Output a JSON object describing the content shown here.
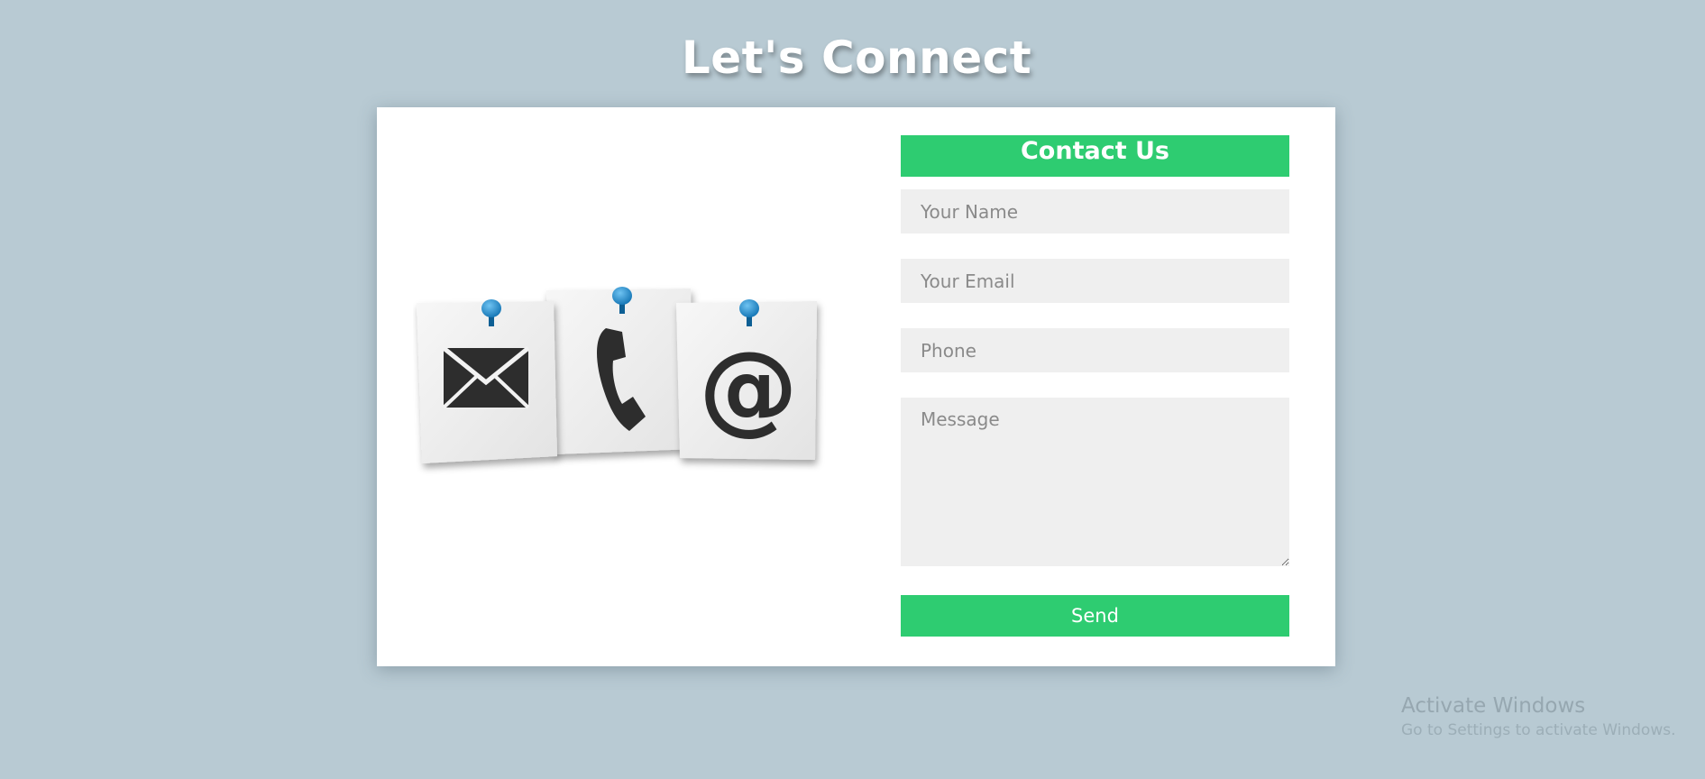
{
  "header": {
    "title": "Let's Connect"
  },
  "contact_form": {
    "heading": "Contact Us",
    "name_placeholder": "Your Name",
    "email_placeholder": "Your Email",
    "phone_placeholder": "Phone",
    "message_placeholder": "Message",
    "send_label": "Send"
  },
  "illustration": {
    "icons": [
      "envelope-icon",
      "telephone-icon",
      "at-sign-icon",
      "push-pin-icon"
    ]
  },
  "windows_watermark": {
    "title": "Activate Windows",
    "subtitle": "Go to Settings to activate Windows."
  },
  "colors": {
    "background": "#b8cad3",
    "accent": "#2ecc71",
    "card": "#ffffff",
    "field_bg": "#efefef",
    "pin": "#1e88c9"
  }
}
